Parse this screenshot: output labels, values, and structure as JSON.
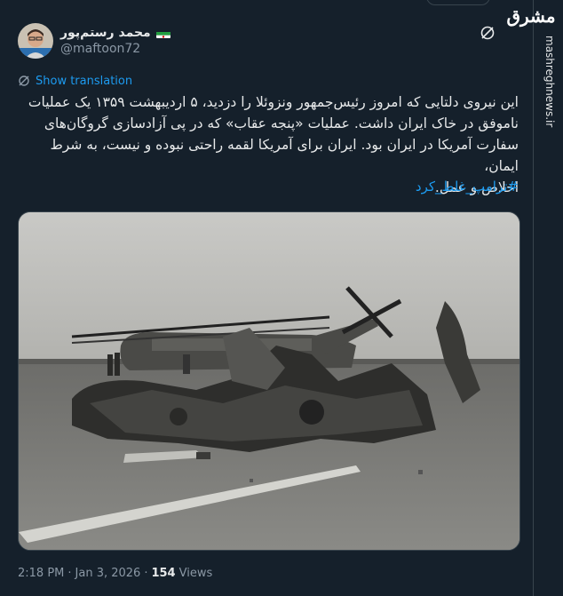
{
  "author": {
    "display_name": "محمد رستم‌پور",
    "handle": "@maftoon72",
    "avatar_icon": "person-avatar",
    "flag_icon": "iran-flag-icon"
  },
  "translation": {
    "label": "Show translation",
    "icon": "translate-icon"
  },
  "tweet": {
    "text": "این نیروی دلتایی که امروز رئیس‌جمهور ونزوئلا را دزدید، ۵ اردیبهشت ۱۳۵۹ یک عملیات\nناموفق در خاک ایران داشت. عملیات «پنجه عقاب» که در پی آزادسازی گروگان‌های\nسفارت آمریکا در ایران بود. ایران برای آمریکا لقمه راحتی نبوده و نیست، به شرط ایمان،\nاخلاص و عمل.",
    "hashtag": "#ترامپ_غلط_کرد"
  },
  "media": {
    "description_icon": "helicopter-wreckage-photo"
  },
  "meta": {
    "time": "2:18 PM",
    "separator": "·",
    "date": "Jan 3, 2026",
    "views_count": "154",
    "views_label": "Views"
  },
  "watermark": {
    "logo": "مشرق",
    "site": "mashreghnews.ir"
  },
  "colors": {
    "background": "#15202b",
    "link": "#1d9bf0",
    "secondary_text": "#8b98a5",
    "primary_text": "#e7e9ea"
  }
}
